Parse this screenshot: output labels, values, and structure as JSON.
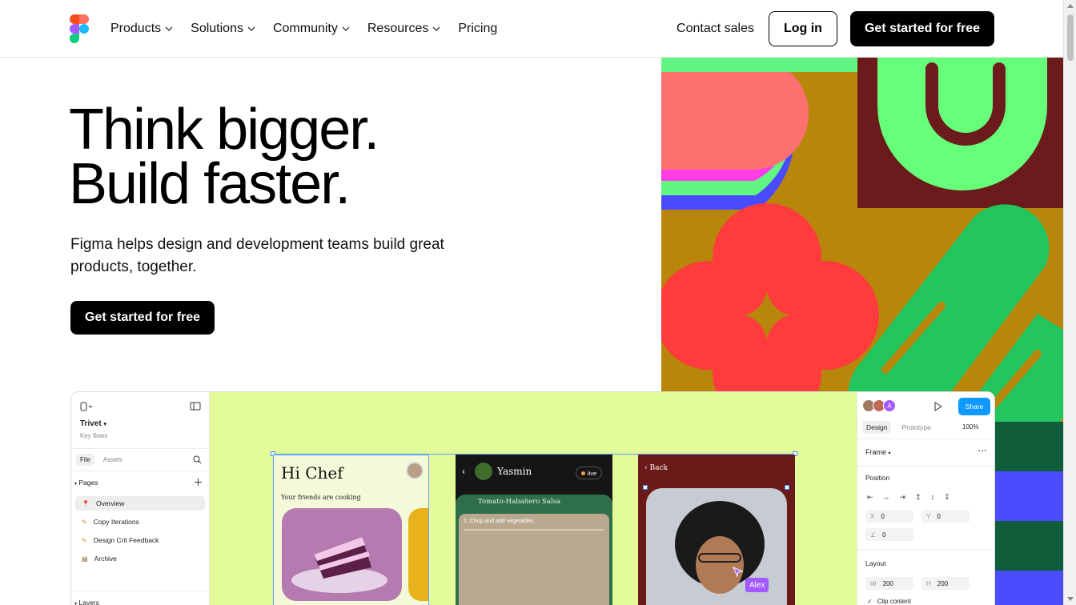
{
  "nav": {
    "items": [
      {
        "label": "Products",
        "dropdown": true
      },
      {
        "label": "Solutions",
        "dropdown": true
      },
      {
        "label": "Community",
        "dropdown": true
      },
      {
        "label": "Resources",
        "dropdown": true
      },
      {
        "label": "Pricing",
        "dropdown": false
      }
    ],
    "contact_label": "Contact sales",
    "login_label": "Log in",
    "cta_label": "Get started for free"
  },
  "hero": {
    "headline_1": "Think bigger.",
    "headline_2": "Build faster.",
    "subhead": "Figma helps design and development teams build great products, together.",
    "cta_label": "Get started for free"
  },
  "editor": {
    "file_name": "Trivet",
    "file_sub": "Key flows",
    "left_tabs": [
      "File",
      "Assets"
    ],
    "pages_label": "Pages",
    "pages": [
      {
        "icon": "pin-icon",
        "label": "Overview",
        "active": true
      },
      {
        "icon": "pencil-icon",
        "label": "Copy Iterations",
        "active": false
      },
      {
        "icon": "pencil-icon",
        "label": "Design Crit Feedback",
        "active": false
      },
      {
        "icon": "archive-icon",
        "label": "Archive",
        "active": false
      }
    ],
    "layers_label": "Layers",
    "frame1": {
      "title": "Hi Chef",
      "subtitle": "Your friends are cooking"
    },
    "frame2": {
      "name": "Yasmin",
      "live": "live",
      "recipe": "Tomato-Habañero Salsa",
      "step": "2.  Chop and add vegetables"
    },
    "frame3": {
      "back": "Back",
      "cursor_name": "Alex"
    },
    "right": {
      "avatar_letter": "A",
      "share": "Share",
      "tabs": [
        "Design",
        "Prototype"
      ],
      "zoom": "100%",
      "frame_label": "Frame",
      "position_label": "Position",
      "x_label": "X",
      "x_value": "0",
      "y_label": "Y",
      "y_value": "0",
      "rot_value": "0",
      "layout_label": "Layout",
      "w_label": "W",
      "w_value": "200",
      "h_label": "H",
      "h_value": "200",
      "clip_label": "Clip content"
    }
  },
  "colors": {
    "brand_black": "#000000",
    "share_blue": "#0d99ff",
    "canvas_lime": "#e4fb9a",
    "selection_blue": "#5aa6ff"
  }
}
